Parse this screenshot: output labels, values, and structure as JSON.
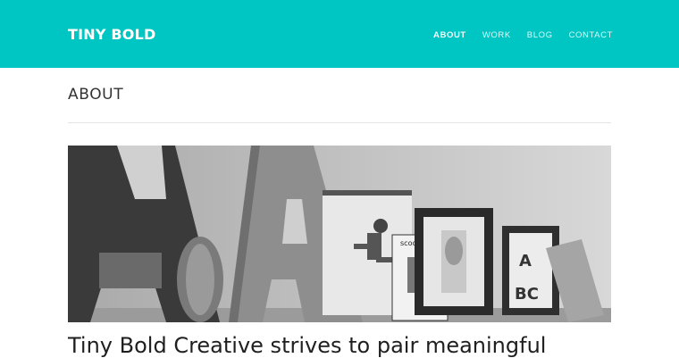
{
  "header": {
    "logo": "TINY BOLD",
    "nav": [
      {
        "label": "ABOUT",
        "active": true
      },
      {
        "label": "WORK",
        "active": false
      },
      {
        "label": "BLOG",
        "active": false
      },
      {
        "label": "CONTACT",
        "active": false
      }
    ],
    "bg_color": "#00c6c3"
  },
  "main": {
    "title": "ABOUT",
    "hero_image": "grayscale-studio-shelf-photo",
    "hero_texts": {
      "book_title": "scootering"
    },
    "headline": "Tiny Bold Creative strives to pair meaningful"
  }
}
